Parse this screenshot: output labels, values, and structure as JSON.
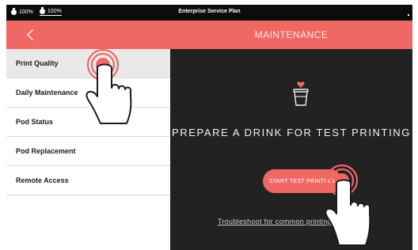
{
  "statusbar": {
    "items": [
      {
        "label": "100%",
        "icon": "battery-icon"
      },
      {
        "label": "100%",
        "icon": "battery-icon"
      }
    ],
    "title": "Enterprise Service Plan"
  },
  "header": {
    "back_icon": "chevron-left-icon",
    "title": "MAINTENANCE",
    "color": "#ef6865"
  },
  "sidebar": {
    "items": [
      {
        "label": "Print Quality",
        "active": true
      },
      {
        "label": "Daily Maintenance"
      },
      {
        "label": "Pod Status"
      },
      {
        "label": "Pod Replacement"
      },
      {
        "label": "Remote Access"
      }
    ]
  },
  "main": {
    "icon": "cup-icon",
    "prepare_text": "PREPARE A DRINK FOR TEST PRINTING",
    "start_button": "START TEST PRINTING",
    "troubleshoot_link": "Troubleshoot for common printing problems"
  },
  "overlays": [
    {
      "name": "tap-hand-icon",
      "target": "Print Quality"
    },
    {
      "name": "tap-hand-icon",
      "target": "START TEST PRINTING"
    }
  ],
  "colors": {
    "accent": "#ef6865",
    "sidebar_bg": "#ffffff",
    "main_bg": "#222222"
  }
}
